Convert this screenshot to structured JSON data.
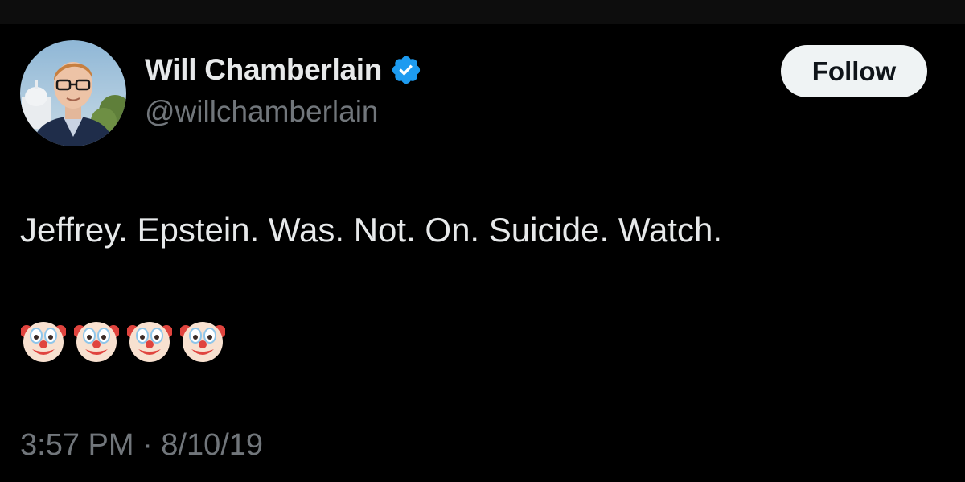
{
  "author": {
    "display_name": "Will Chamberlain",
    "handle": "@willchamberlain",
    "verified": true,
    "avatar_icon": "profile-photo"
  },
  "follow_button": {
    "label": "Follow"
  },
  "tweet": {
    "text": "Jeffrey. Epstein. Was. Not. On. Suicide. Watch.",
    "emojis": [
      "clown-face-emoji",
      "clown-face-emoji",
      "clown-face-emoji",
      "clown-face-emoji"
    ]
  },
  "meta": {
    "timestamp": "3:57 PM · 8/10/19"
  },
  "colors": {
    "background": "#000000",
    "primary_text": "#e7e9ea",
    "secondary_text": "#71767b",
    "verified_badge": "#1d9bf0",
    "follow_button_bg": "#eff3f4"
  }
}
